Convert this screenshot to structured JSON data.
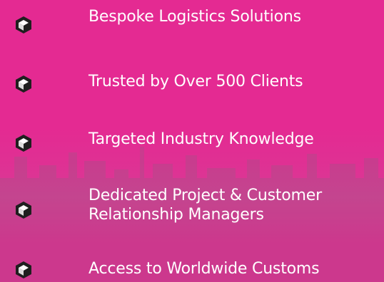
{
  "features": [
    {
      "label": "Bespoke Logistics Solutions",
      "icon": "hexagon-badge-icon"
    },
    {
      "label": "Trusted by Over 500 Clients",
      "icon": "hexagon-badge-icon"
    },
    {
      "label": "Targeted Industry Knowledge",
      "icon": "hexagon-badge-icon"
    },
    {
      "label": "Dedicated Project & Customer",
      "label2": "Relationship Managers",
      "icon": "hexagon-badge-icon"
    },
    {
      "label": "Access to Worldwide Customs",
      "icon": "hexagon-badge-icon"
    }
  ],
  "colors": {
    "background": "#e42a92",
    "text": "#ffffff",
    "icon_fill": "#222222",
    "icon_accent": "#ffffff"
  }
}
